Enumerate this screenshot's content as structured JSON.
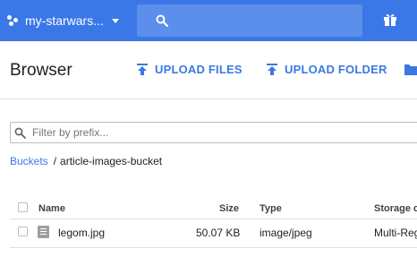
{
  "topbar": {
    "project_name": "my-starwars...",
    "search_placeholder": "",
    "color": "#3b78e7"
  },
  "header": {
    "title": "Browser",
    "upload_files_label": "UPLOAD FILES",
    "upload_folder_label": "UPLOAD FOLDER",
    "accent_color": "#3a78e4"
  },
  "filter": {
    "placeholder": "Filter by prefix...",
    "value": ""
  },
  "breadcrumb": {
    "root_label": "Buckets",
    "separator": "/",
    "current": "article-images-bucket"
  },
  "table": {
    "columns": [
      "Name",
      "Size",
      "Type",
      "Storage c"
    ],
    "rows": [
      {
        "name": "legom.jpg",
        "size": "50.07 KB",
        "type": "image/jpeg",
        "storage": "Multi-Reg",
        "icon": "file-icon"
      }
    ]
  }
}
